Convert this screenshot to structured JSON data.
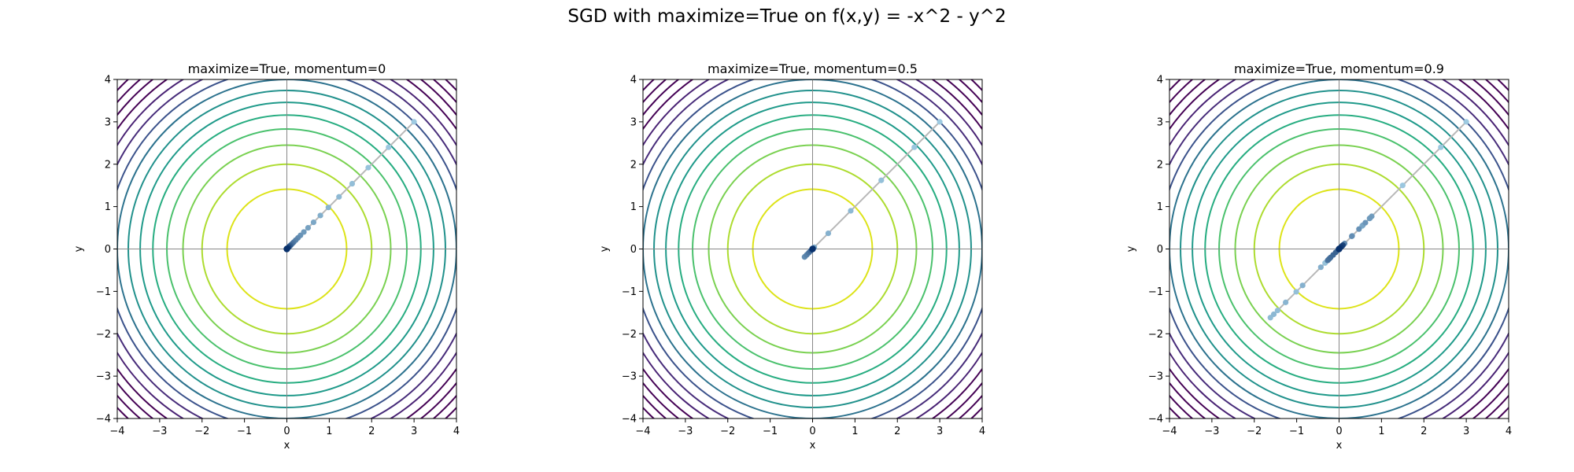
{
  "figure": {
    "title": "SGD with maximize=True on f(x,y) = -x^2 - y^2"
  },
  "colors": {
    "contour_levels_inner_to_outer": [
      "#dde318",
      "#addc30",
      "#7ad151",
      "#4ac16d",
      "#27ad81",
      "#1f9a8a",
      "#21918c",
      "#2c728e",
      "#3b528b",
      "#472c7a",
      "#482173",
      "#440154"
    ],
    "path_line": "#b8b8b8",
    "point_early": "#9ecae1",
    "point_late": "#08306b",
    "axis_guides": "#888888"
  },
  "chart_data": [
    {
      "type": "line",
      "title": "maximize=True, momentum=0",
      "xlabel": "x",
      "ylabel": "y",
      "xlim": [
        -4,
        4
      ],
      "ylim": [
        -4,
        4
      ],
      "xticks": [
        "−4",
        "−3",
        "−2",
        "−1",
        "0",
        "1",
        "2",
        "3",
        "4"
      ],
      "yticks": [
        "−4",
        "−3",
        "−2",
        "−1",
        "0",
        "1",
        "2",
        "3",
        "4"
      ],
      "contour_radii": [
        1.41,
        2.0,
        2.45,
        2.83,
        3.16,
        3.46,
        3.74,
        4.0,
        4.24,
        4.47,
        4.69,
        4.9,
        5.1,
        5.29,
        5.48,
        5.66
      ],
      "grid": false,
      "guides_at_zero": true,
      "series": [
        {
          "x": [
            3.0,
            2.4,
            1.92,
            1.54,
            1.23,
            0.98,
            0.79,
            0.63,
            0.5,
            0.4,
            0.32,
            0.26,
            0.21,
            0.16,
            0.13,
            0.1,
            0.08,
            0.07,
            0.05,
            0.04,
            0.03,
            0.02,
            0.0
          ],
          "y": [
            3.0,
            2.4,
            1.92,
            1.54,
            1.23,
            0.98,
            0.79,
            0.63,
            0.5,
            0.4,
            0.32,
            0.26,
            0.21,
            0.16,
            0.13,
            0.1,
            0.08,
            0.07,
            0.05,
            0.04,
            0.03,
            0.02,
            0.0
          ]
        }
      ]
    },
    {
      "type": "line",
      "title": "maximize=True, momentum=0.5",
      "xlabel": "x",
      "ylabel": "y",
      "xlim": [
        -4,
        4
      ],
      "ylim": [
        -4,
        4
      ],
      "xticks": [
        "−4",
        "−3",
        "−2",
        "−1",
        "0",
        "1",
        "2",
        "3",
        "4"
      ],
      "yticks": [
        "−4",
        "−3",
        "−2",
        "−1",
        "0",
        "1",
        "2",
        "3",
        "4"
      ],
      "contour_radii": [
        1.41,
        2.0,
        2.45,
        2.83,
        3.16,
        3.46,
        3.74,
        4.0,
        4.24,
        4.47,
        4.69,
        4.9,
        5.1,
        5.29,
        5.48,
        5.66
      ],
      "grid": false,
      "guides_at_zero": true,
      "series": [
        {
          "x": [
            3.0,
            2.4,
            1.62,
            0.9,
            0.37,
            0.04,
            -0.13,
            -0.19,
            -0.18,
            -0.14,
            -0.09,
            -0.05,
            -0.02,
            0.0,
            0.01,
            0.01,
            0.0
          ],
          "y": [
            3.0,
            2.4,
            1.62,
            0.9,
            0.37,
            0.04,
            -0.13,
            -0.19,
            -0.18,
            -0.14,
            -0.09,
            -0.05,
            -0.02,
            0.0,
            0.01,
            0.01,
            0.0
          ]
        }
      ]
    },
    {
      "type": "line",
      "title": "maximize=True, momentum=0.9",
      "xlabel": "x",
      "ylabel": "y",
      "xlim": [
        -4,
        4
      ],
      "ylim": [
        -4,
        4
      ],
      "xticks": [
        "−4",
        "−3",
        "−2",
        "−1",
        "0",
        "1",
        "2",
        "3",
        "4"
      ],
      "yticks": [
        "−4",
        "−3",
        "−2",
        "−1",
        "0",
        "1",
        "2",
        "3",
        "4"
      ],
      "contour_radii": [
        1.41,
        2.0,
        2.45,
        2.83,
        3.16,
        3.46,
        3.74,
        4.0,
        4.24,
        4.47,
        4.69,
        4.9,
        5.1,
        5.29,
        5.48,
        5.66
      ],
      "grid": false,
      "guides_at_zero": true,
      "series": [
        {
          "x": [
            3.0,
            2.4,
            1.5,
            0.54,
            -0.33,
            -1.01,
            -1.45,
            -1.62,
            -1.54,
            -1.26,
            -0.86,
            -0.43,
            -0.03,
            0.31,
            0.56,
            0.72,
            0.77,
            0.73,
            0.62,
            0.47,
            0.3,
            0.13,
            -0.02,
            -0.14,
            -0.22,
            -0.26,
            -0.27,
            -0.24,
            -0.2,
            -0.14,
            -0.08,
            -0.02,
            0.02,
            0.06,
            0.08,
            0.09,
            0.09,
            0.08,
            0.06,
            0.04,
            0.02,
            0.0
          ],
          "y": [
            3.0,
            2.4,
            1.5,
            0.54,
            -0.33,
            -1.01,
            -1.45,
            -1.62,
            -1.54,
            -1.26,
            -0.86,
            -0.43,
            -0.03,
            0.31,
            0.56,
            0.72,
            0.77,
            0.73,
            0.62,
            0.47,
            0.3,
            0.13,
            -0.02,
            -0.14,
            -0.22,
            -0.26,
            -0.27,
            -0.24,
            -0.2,
            -0.14,
            -0.08,
            -0.02,
            0.02,
            0.06,
            0.08,
            0.09,
            0.09,
            0.08,
            0.06,
            0.04,
            0.02,
            0.0
          ]
        }
      ]
    }
  ]
}
